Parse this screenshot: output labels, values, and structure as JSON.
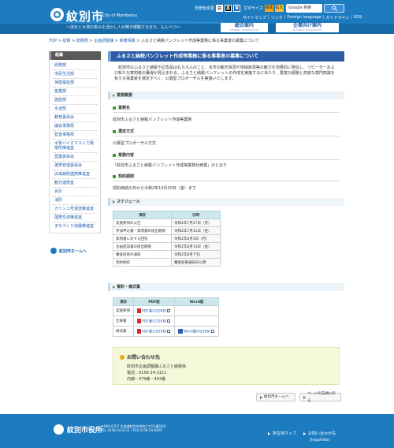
{
  "header": {
    "site_name_jp": "紋別市",
    "site_name_en": "City of Mombetsu",
    "tagline": "～流氷と大地の恵みを活かし人が輝き躍動するまち、もんべつ～",
    "bg_color_label": "背景色変更",
    "bg_buttons": [
      "白",
      "黒",
      "青"
    ],
    "font_size_label": "文字サイズ",
    "font_sizes": [
      "標準",
      "拡大"
    ],
    "search_placeholder": "Google 検索",
    "links": [
      "サイトマップ",
      "リンク",
      "Foreign language",
      "ガイドライン",
      "RSS"
    ],
    "nav_guide": {
      "title": "総合案内",
      "sub": "GENERAL INFORMATION"
    },
    "nav_biz": {
      "title": "企業向け案内",
      "sub": "BUSINESS INFORMATION"
    }
  },
  "breadcrumb": [
    "TOP",
    "総務",
    "総務部",
    "企画調整課",
    "新着情報",
    "ふるさと納税パンフレット作成等業務に係る事業者の募集について"
  ],
  "sidebar": {
    "heading": "組織",
    "items": [
      "総務部",
      "市民生活部",
      "保健福祉部",
      "産業部",
      "建設部",
      "水道部",
      "教育委員会",
      "議会事務局",
      "監査事務局",
      "木質バイオマス人力発電所推進室",
      "農業委員会",
      "選挙管理委員会",
      "広域病院連携推進室",
      "観光連携室",
      "会計",
      "消防",
      "ガリンコ号運送推進室",
      "国際交流推進室",
      "まちづくり協働推進室"
    ],
    "home_link": "紋別市ホームへ"
  },
  "main": {
    "title": "ふるさと納税パンフレット作成等業務に係る事業者の募集について",
    "intro": "紋別市のふるさと納税や記念品はもちろんのこと、本市の観光資源や地域資源等の魅力を効果的に発信し、リピーターおよび新たな寄附者の獲得が見込まれる、ふるさと納税パンフレットの作成を実施するにあたり、豊富な経験と高度な専門知識を有する事業者を選定すべく、公募型プロポーザルを実施いたします。",
    "section_overview": "業務概要",
    "sub_name": "業務名",
    "name_text": "紋別市ふるさと納税パンフレット作成等業務",
    "sub_method": "選定方式",
    "method_text": "公募型プロポーザル方式",
    "sub_content": "業務内容",
    "content_text": "「紋別市ふるさと納税パンフレット作成等業務仕様書」のとおり",
    "sub_period": "契約期間",
    "period_text": "契約締結の日から令和2年10月30日（金）まで",
    "section_schedule": "スケジュール",
    "schedule_headers": [
      "項目",
      "日時"
    ],
    "schedule": [
      [
        "実施要領の公告",
        "令和2年7月27日（月）"
      ],
      [
        "参加申込書・質問書の提出期限",
        "令和2年7月31日（金）"
      ],
      [
        "質問書に対する回答",
        "令和2年8月3日（月）"
      ],
      [
        "企画提案書の提出期限",
        "令和2年8月14日（金）"
      ],
      [
        "審査結果の通知",
        "令和2年8月下旬"
      ],
      [
        "契約締結",
        "審査結果通知日以降"
      ]
    ],
    "section_docs": "資料・様式集",
    "docs_headers": [
      "項目",
      "PDF版",
      "Word版"
    ],
    "docs": [
      {
        "item": "実施要領",
        "pdf": "PDF版(220KB)",
        "word": ""
      },
      {
        "item": "仕様書",
        "pdf": "PDF版(215KB)",
        "word": ""
      },
      {
        "item": "様式集",
        "pdf": "PDF版(181KB)",
        "word": "Word版(425KB)"
      }
    ],
    "contact_title": "お問い合わせ先",
    "contact_dept": "紋別市企画調整課ふるさと納税係",
    "contact_tel": "電話：0158-24-2111",
    "contact_ext": "内線：479番・443番",
    "btn_home": "紋別市ホームへ",
    "btn_top": "ページの先頭に戻る"
  },
  "footer": {
    "name": "紋別市役所",
    "address": "〒094-8707 北海道紋別市幸町2丁目1番18号",
    "tel": "TEL 0158-24-2111 / FAX 0158-24-6925",
    "map_link": "所在地マップ",
    "inquiry_link": "お問い合わせ先",
    "inquiry_en": "(Inquiries)"
  }
}
